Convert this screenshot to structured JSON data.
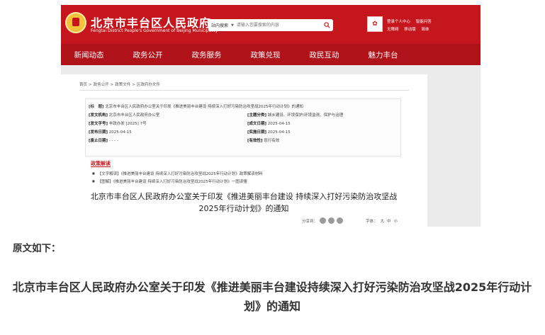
{
  "header": {
    "site_title": "北京市丰台区人民政府",
    "site_subtitle": "Fengtai District People's Government of Beijing Municipality",
    "search_scope": "站内搜索",
    "search_placeholder": "请输入您要搜索的内容",
    "links_top": [
      "登录个人中心",
      "智能问答"
    ],
    "links_bottom": [
      "无障碍",
      "移动版",
      "简体"
    ]
  },
  "nav": [
    "新闻动态",
    "政务公开",
    "政务服务",
    "政策兑现",
    "政民互动",
    "魅力丰台"
  ],
  "breadcrumb": [
    "首页",
    "政务公开",
    "政策文件",
    "区政府办文件"
  ],
  "meta": {
    "title_label": "[标　题]",
    "title_value": "北京市丰台区人民政府办公室关于印发《推进美丽丰台建设 持续深入打好污染防治攻坚战2025年行动计划》的通知",
    "rows_left": [
      {
        "label": "[发文机构]",
        "value": "北京市丰台区人民政府办公室"
      },
      {
        "label": "[发文字号]",
        "value": "丰政办发 [2025] 7号"
      },
      {
        "label": "[发布日期]",
        "value": "2025-04-15"
      },
      {
        "label": "[废止日期]",
        "value": "- - - -"
      }
    ],
    "rows_right": [
      {
        "label": "[主题分类]",
        "value": "城乡建设、环境保护/环境监测、保护与治理"
      },
      {
        "label": "[成文日期]",
        "value": "2025-04-15"
      },
      {
        "label": "[实施日期]",
        "value": "2025-04-15"
      },
      {
        "label": "[有效性]",
        "value": "现行有效"
      }
    ]
  },
  "policy_interpretation": {
    "title": "政策解读",
    "items": [
      "【文字解读】《推进美丽丰台建设 持续深入打好污染防治攻坚战2025年行动计划》政策解读材料",
      "【图解】《推进美丽丰台建设 持续深入打好污染防治攻坚战2025年行动计划》一图读懂"
    ]
  },
  "document_title": "北京市丰台区人民政府办公室关于印发《推进美丽丰台建设 持续深入打好污染防治攻坚战2025年行动计划》的通知",
  "share_label": "分享到：",
  "font_size": {
    "label": "字体：",
    "options": [
      "大",
      "中",
      "小"
    ]
  },
  "intro_text": "原文如下：",
  "article_title": "北京市丰台区人民政府办公室关于印发《推进美丽丰台建设持续深入打好污染防治攻坚战2025年行动计划》的通知"
}
